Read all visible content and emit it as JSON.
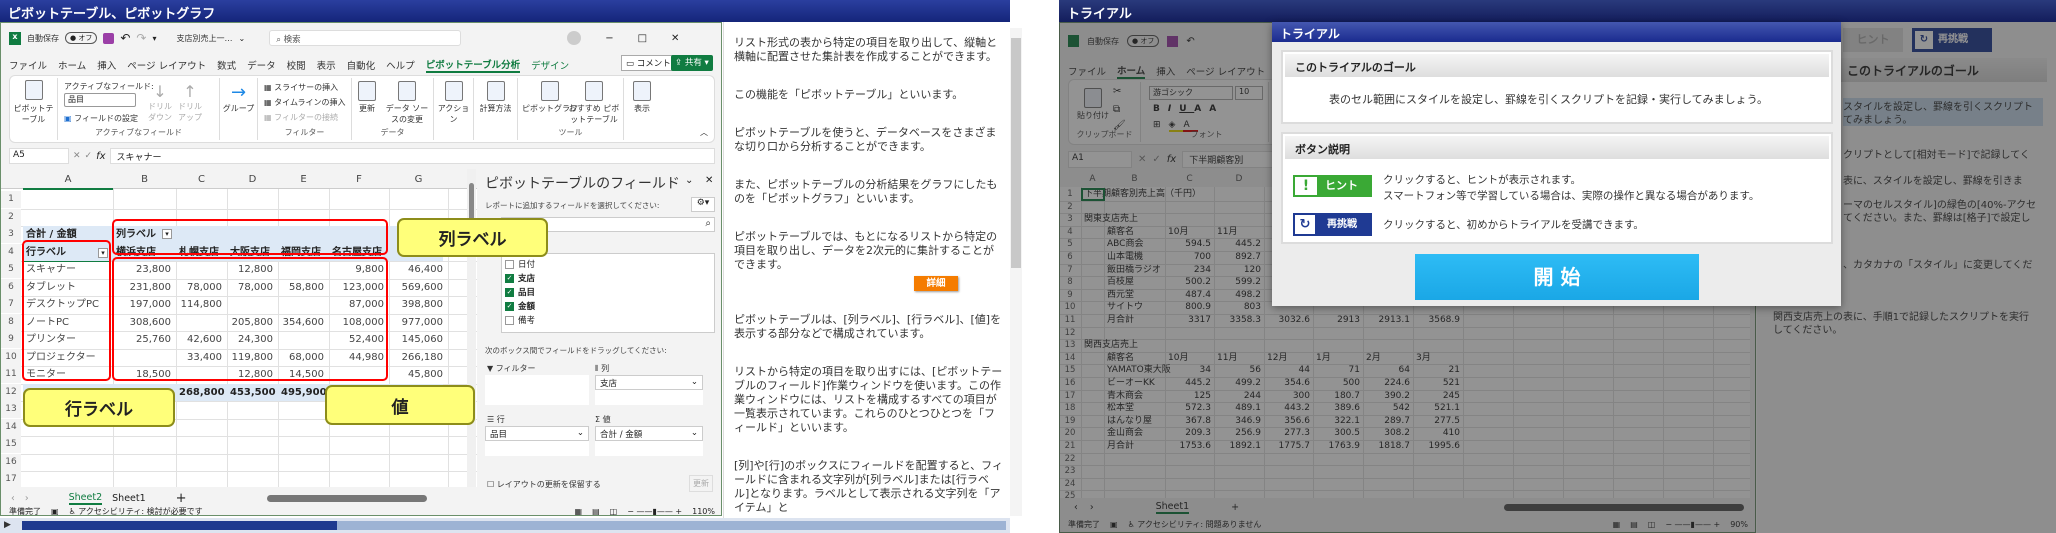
{
  "left": {
    "title": "ピボットテーブル、ピボットグラフ",
    "qat": {
      "autosave": "自動保存",
      "toggle": "オフ",
      "filename": "支店別売上一…",
      "search_placeholder": "検索"
    },
    "tabs": [
      "ファイル",
      "ホーム",
      "挿入",
      "ページ レイアウト",
      "数式",
      "データ",
      "校閲",
      "表示",
      "自動化",
      "ヘルプ",
      "ピボットテーブル分析",
      "デザイン"
    ],
    "comment": "コメント",
    "share": "共有",
    "ribbon": {
      "pivot": "ピボットテーブル",
      "active_field_label": "アクティブなフィールド:",
      "active_field_value": "品目",
      "field_settings": "フィールドの設定",
      "drill_down": "ドリル ダウン",
      "drill_up": "ドリル アップ",
      "group_active": "アクティブなフィールド",
      "group": "グループ",
      "slicer": "スライサーの挿入",
      "timeline": "タイムラインの挿入",
      "filter_conn": "フィルターの接続",
      "group_filter": "フィルター",
      "refresh": "更新",
      "change_source": "データ ソースの変更",
      "group_data": "データ",
      "actions": "アクション",
      "calc": "計算方法",
      "pivot_chart": "ピボットグラフ",
      "recommended": "おすすめ ピボットテーブル",
      "group_tools": "ツール",
      "show": "表示"
    },
    "formula": {
      "name_box": "A5",
      "fx": "fx",
      "value": "スキャナー"
    },
    "columns": [
      "A",
      "B",
      "C",
      "D",
      "E",
      "F",
      "G"
    ],
    "rows": [
      "1",
      "2",
      "3",
      "4",
      "5",
      "6",
      "7",
      "8",
      "9",
      "10",
      "11",
      "12",
      "13",
      "14",
      "15",
      "16",
      "17"
    ],
    "pivot": {
      "sum_label": "合計 / 金額",
      "col_label": "列ラベル",
      "row_label": "行ラベル",
      "branches": [
        "横浜支店",
        "札幌支店",
        "大阪支店",
        "福岡支店",
        "名古屋支店"
      ],
      "items": [
        {
          "name": "スキャナー",
          "values": [
            "23,800",
            "",
            "12,800",
            "",
            "9,800",
            "46,400"
          ]
        },
        {
          "name": "タブレット",
          "values": [
            "231,800",
            "78,000",
            "78,000",
            "58,800",
            "123,000",
            "569,600"
          ]
        },
        {
          "name": "デスクトップPC",
          "values": [
            "197,000",
            "114,800",
            "",
            "",
            "87,000",
            "398,800"
          ]
        },
        {
          "name": "ノートPC",
          "values": [
            "308,600",
            "",
            "205,800",
            "354,600",
            "108,000",
            "977,000"
          ]
        },
        {
          "name": "プリンター",
          "values": [
            "25,760",
            "42,600",
            "24,300",
            "",
            "52,400",
            "145,060"
          ]
        },
        {
          "name": "プロジェクター",
          "values": [
            "",
            "33,400",
            "119,800",
            "68,000",
            "44,980",
            "266,180"
          ]
        },
        {
          "name": "モニター",
          "values": [
            "18,500",
            "",
            "12,800",
            "14,500",
            "",
            "45,800"
          ]
        }
      ],
      "totals": [
        "268,800",
        "453,500",
        "495,900"
      ]
    },
    "callouts": {
      "col": "列ラベル",
      "row": "行ラベル",
      "val": "値"
    },
    "field_pane": {
      "title": "ピボットテーブルのフィールド",
      "instruction": "レポートに追加するフィールドを選択してください:",
      "fields": [
        {
          "name": "日付",
          "checked": false
        },
        {
          "name": "支店",
          "checked": true
        },
        {
          "name": "品目",
          "checked": true
        },
        {
          "name": "金額",
          "checked": true
        },
        {
          "name": "備考",
          "checked": false
        }
      ],
      "drag_instruction": "次のボックス間でフィールドをドラッグしてください:",
      "filter": "フィルター",
      "columns": "列",
      "rows": "行",
      "values": "値",
      "col_value": "支店",
      "row_value": "品目",
      "val_value": "合計 / 金額",
      "defer": "レイアウトの更新を保留する",
      "update": "更新"
    },
    "sheets": [
      "Sheet2",
      "Sheet1"
    ],
    "active_sheet": "Sheet2",
    "status": {
      "ready": "準備完了",
      "accessibility": "アクセシビリティ: 検討が必要です",
      "zoom": "110%"
    },
    "progress": 0.32
  },
  "explanation": {
    "paragraphs": [
      "リスト形式の表から特定の項目を取り出して、縦軸と横軸に配置させた集計表を作成することができます。",
      "この機能を「ピボットテーブル」といいます。",
      "ピボットテーブルを使うと、データベースをさまざまな切り口から分析することができます。",
      "また、ピボットテーブルの分析結果をグラフにしたものを「ピボットグラフ」といいます。",
      "ピボットテーブルでは、もとになるリストから特定の項目を取り出し、データを2次元的に集計することができます。",
      "ピボットテーブルは、[列ラベル]、[行ラベル]、[値]を表示する部分などで構成されています。",
      "リストから特定の項目を取り出すには、[ピボットテーブルのフィールド]作業ウィンドウを使います。この作業ウィンドウには、リストを構成するすべての項目が一覧表示されています。これらのひとつひとつを「フィールド」といいます。",
      "[列]や[行]のボックスにフィールドを配置すると、フィールドに含まれる文字列が[列ラベル]または[行ラベル]となります。ラベルとして表示される文字列を「アイテム」と"
    ],
    "detail_button": "詳細",
    "detail_color": "#f57c00"
  },
  "right": {
    "title": "トライアル",
    "qat": {
      "autosave": "自動保存",
      "toggle": "オフ"
    },
    "tabs": [
      "ファイル",
      "ホーム",
      "挿入",
      "ページ レイアウト",
      "数式"
    ],
    "ribbon": {
      "paste": "貼り付け",
      "clipboard": "クリップボード",
      "font_name": "游ゴシック",
      "font_size": "10",
      "font": "フォント"
    },
    "formula": {
      "name_box": "A1",
      "value": "下半期顧客別"
    },
    "columns": [
      "A",
      "B",
      "C",
      "D"
    ],
    "sheet_rows": [
      [
        "1",
        "下半期顧客別売上高（千円）",
        "",
        "",
        "",
        "",
        "",
        "",
        ""
      ],
      [
        "2",
        "",
        "",
        "",
        "",
        "",
        "",
        "",
        ""
      ],
      [
        "3",
        "関東支店売上",
        "",
        "",
        "",
        "",
        "",
        "",
        ""
      ],
      [
        "4",
        "",
        "顧客名",
        "10月",
        "11月",
        "",
        "",
        "",
        ""
      ],
      [
        "5",
        "",
        "ABC商会",
        "594.5",
        "445.2",
        "",
        "",
        "",
        ""
      ],
      [
        "6",
        "",
        "山本電機",
        "700",
        "892.7",
        "",
        "",
        "",
        ""
      ],
      [
        "7",
        "",
        "飯田橋ラジオ",
        "234",
        "120",
        "",
        "",
        "",
        ""
      ],
      [
        "8",
        "",
        "百枝屋",
        "500.2",
        "599.2",
        "",
        "",
        "",
        ""
      ],
      [
        "9",
        "",
        "西元堂",
        "487.4",
        "498.2",
        "",
        "",
        "",
        ""
      ],
      [
        "10",
        "",
        "サイトウ",
        "800.9",
        "803",
        "",
        "",
        "",
        ""
      ],
      [
        "11",
        "",
        "月合計",
        "3317",
        "3358.3",
        "3032.6",
        "2913",
        "2913.1",
        "3568.9"
      ],
      [
        "12",
        "",
        "",
        "",
        "",
        "",
        "",
        "",
        ""
      ],
      [
        "13",
        "関西支店売上",
        "",
        "",
        "",
        "",
        "",
        "",
        ""
      ],
      [
        "14",
        "",
        "顧客名",
        "10月",
        "11月",
        "12月",
        "1月",
        "2月",
        "3月"
      ],
      [
        "15",
        "",
        "YAMATO東大阪",
        "34",
        "56",
        "44",
        "71",
        "64",
        "21"
      ],
      [
        "16",
        "",
        "ビーオーKK",
        "445.2",
        "499.2",
        "354.6",
        "500",
        "224.6",
        "521"
      ],
      [
        "17",
        "",
        "青木商会",
        "125",
        "244",
        "300",
        "180.7",
        "390.2",
        "245"
      ],
      [
        "18",
        "",
        "松本堂",
        "572.3",
        "489.1",
        "443.2",
        "389.6",
        "542",
        "521.1"
      ],
      [
        "19",
        "",
        "はんなり屋",
        "367.8",
        "346.9",
        "356.6",
        "322.1",
        "289.7",
        "277.5"
      ],
      [
        "20",
        "",
        "金山商会",
        "209.3",
        "256.9",
        "277.3",
        "300.5",
        "308.2",
        "410"
      ],
      [
        "21",
        "",
        "月合計",
        "1753.6",
        "1892.1",
        "1775.7",
        "1763.9",
        "1818.7",
        "1995.6"
      ],
      [
        "22",
        "",
        "",
        "",
        "",
        "",
        "",
        "",
        ""
      ],
      [
        "23",
        "",
        "",
        "",
        "",
        "",
        "",
        "",
        ""
      ],
      [
        "24",
        "",
        "",
        "",
        "",
        "",
        "",
        "",
        ""
      ],
      [
        "25",
        "",
        "",
        "",
        "",
        "",
        "",
        "",
        ""
      ]
    ],
    "sheet_tab": "Sheet1",
    "status": {
      "ready": "準備完了",
      "accessibility": "アクセシビリティ: 問題ありません",
      "zoom": "90%"
    },
    "top_buttons": {
      "hint": "ヒント",
      "retry": "再挑戦"
    },
    "panel": {
      "goal_header": "このトライアルのゴール",
      "lines": [
        "スタイルを設定し、罫線を引くスクリプト",
        "てみましょう。",
        "クリプトとして[相対モード]で記録してく",
        "表に、スタイルを設定し、罫線を引きま",
        "ーマのセルスタイル]の緑色の[40%-アクセ",
        "てください。また、罫線は[格子]で設定し",
        "、カタカナの「スタイル」に変更してくだ",
        "関西支店売上の表に、手順1で記録したスクリプトを実行",
        "してください。"
      ]
    },
    "modal": {
      "title": "トライアル",
      "goal_header": "このトライアルのゴール",
      "goal_text": "表のセル範囲にスタイルを設定し、罫線を引くスクリプトを記録・実行してみましょう。",
      "buttons_header": "ボタン説明",
      "hint_label": "ヒント",
      "hint_desc1": "クリックすると、ヒントが表示されます。",
      "hint_desc2": "スマートフォン等で学習している場合は、実際の操作と異なる場合があります。",
      "retry_label": "再挑戦",
      "retry_desc": "クリックすると、初めからトライアルを受講できます。",
      "start": "開 始",
      "hint_color": "#3aa935",
      "retry_color": "#1f3a93",
      "start_color": "#1aa7e6"
    }
  }
}
